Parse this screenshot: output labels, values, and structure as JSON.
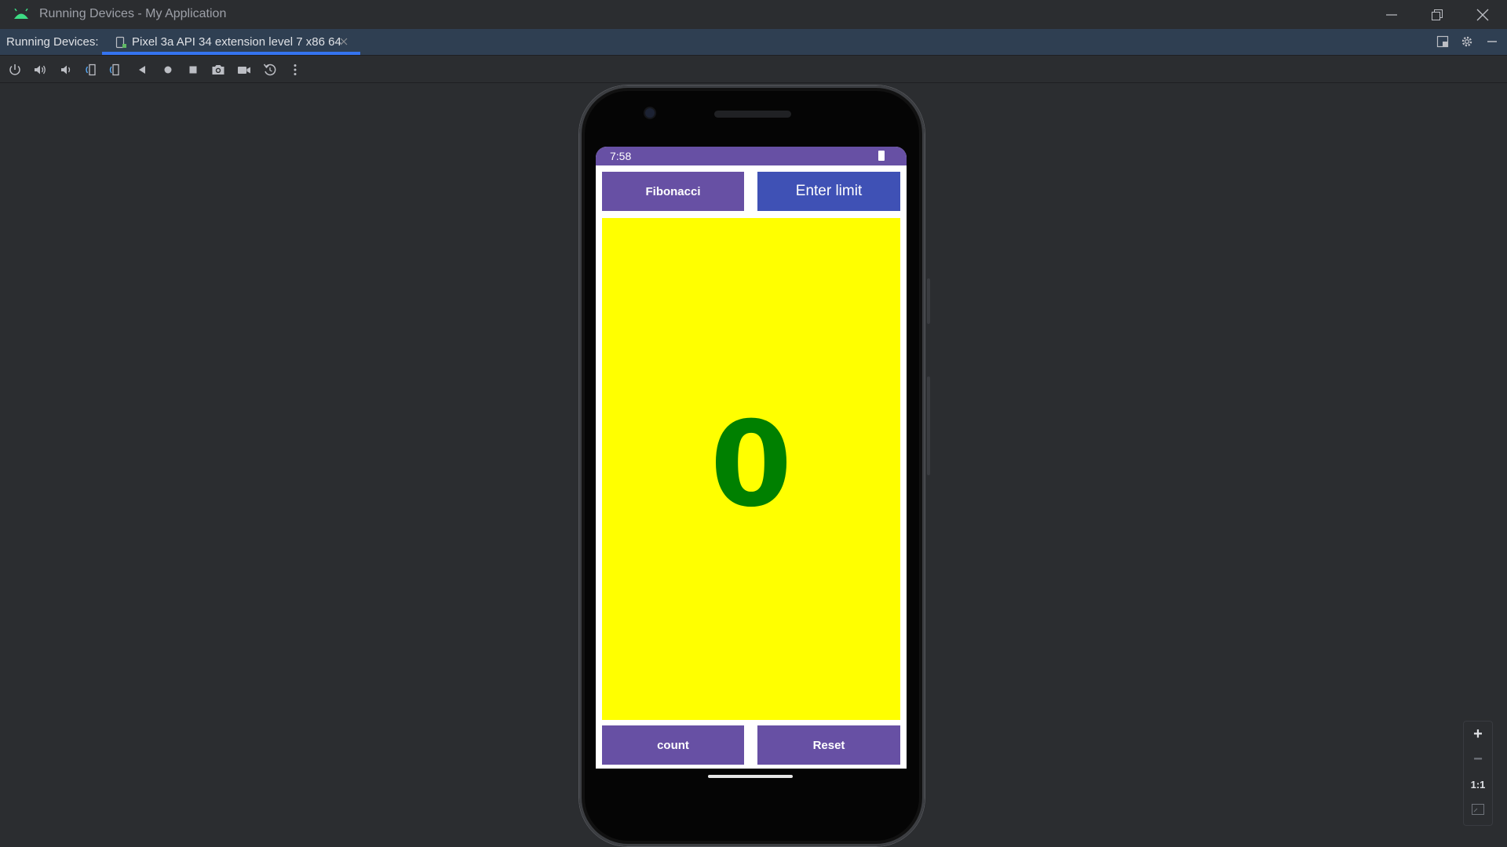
{
  "window": {
    "title": "Running Devices - My Application",
    "controls": [
      "minimize-icon",
      "restore-icon",
      "close-icon"
    ]
  },
  "tabbar": {
    "panel_label": "Running Devices:",
    "device_tab": {
      "label": "Pixel 3a API 34 extension level 7 x86 64",
      "icon": "device-icon"
    },
    "right_icons": [
      "layout-icon",
      "gear-icon",
      "hide-icon"
    ]
  },
  "toolbar": {
    "buttons": [
      "power-icon",
      "volume-up-icon",
      "volume-down-icon",
      "rotate-left-icon",
      "rotate-right-icon",
      "back-icon",
      "home-icon",
      "overview-icon",
      "camera-icon",
      "video-icon",
      "reset-icon",
      "more-icon"
    ]
  },
  "device": {
    "status_time": "7:58",
    "app": {
      "fibonacci_label": "Fibonacci",
      "enter_limit_label": "Enter limit",
      "count_value": "0",
      "count_label": "count",
      "reset_label": "Reset"
    },
    "colors": {
      "primary": "#6750a4",
      "limit_button": "#3f51b5",
      "display_bg": "#ffff00",
      "count_text": "#008000"
    }
  },
  "zoom": {
    "zoom_in": "+",
    "zoom_out": "−",
    "actual_size": "1:1"
  }
}
